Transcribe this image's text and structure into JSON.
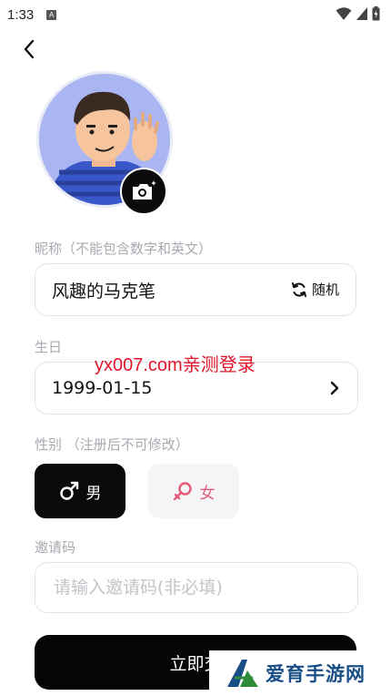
{
  "status_bar": {
    "time": "1:33",
    "notif_letter": "A"
  },
  "nickname": {
    "label": "昵称（不能包含数字和英文）",
    "value": "风趣的马克笔",
    "random_label": "随机"
  },
  "birthday": {
    "label": "生日",
    "value": "1999-01-15"
  },
  "watermark": "yx007.com亲测登录",
  "gender": {
    "label": "性别 （注册后不可修改）",
    "male_label": "男",
    "female_label": "女"
  },
  "invite": {
    "label": "邀请码",
    "placeholder": "请输入邀请码(非必填)"
  },
  "submit_label": "立即交",
  "brand_text": "爱育手游网",
  "colors": {
    "primary": "#000000",
    "accent_female": "#e35b7a",
    "watermark": "#e0172a",
    "label_gray": "#a9a9b1",
    "brand": "#1a4e86"
  }
}
